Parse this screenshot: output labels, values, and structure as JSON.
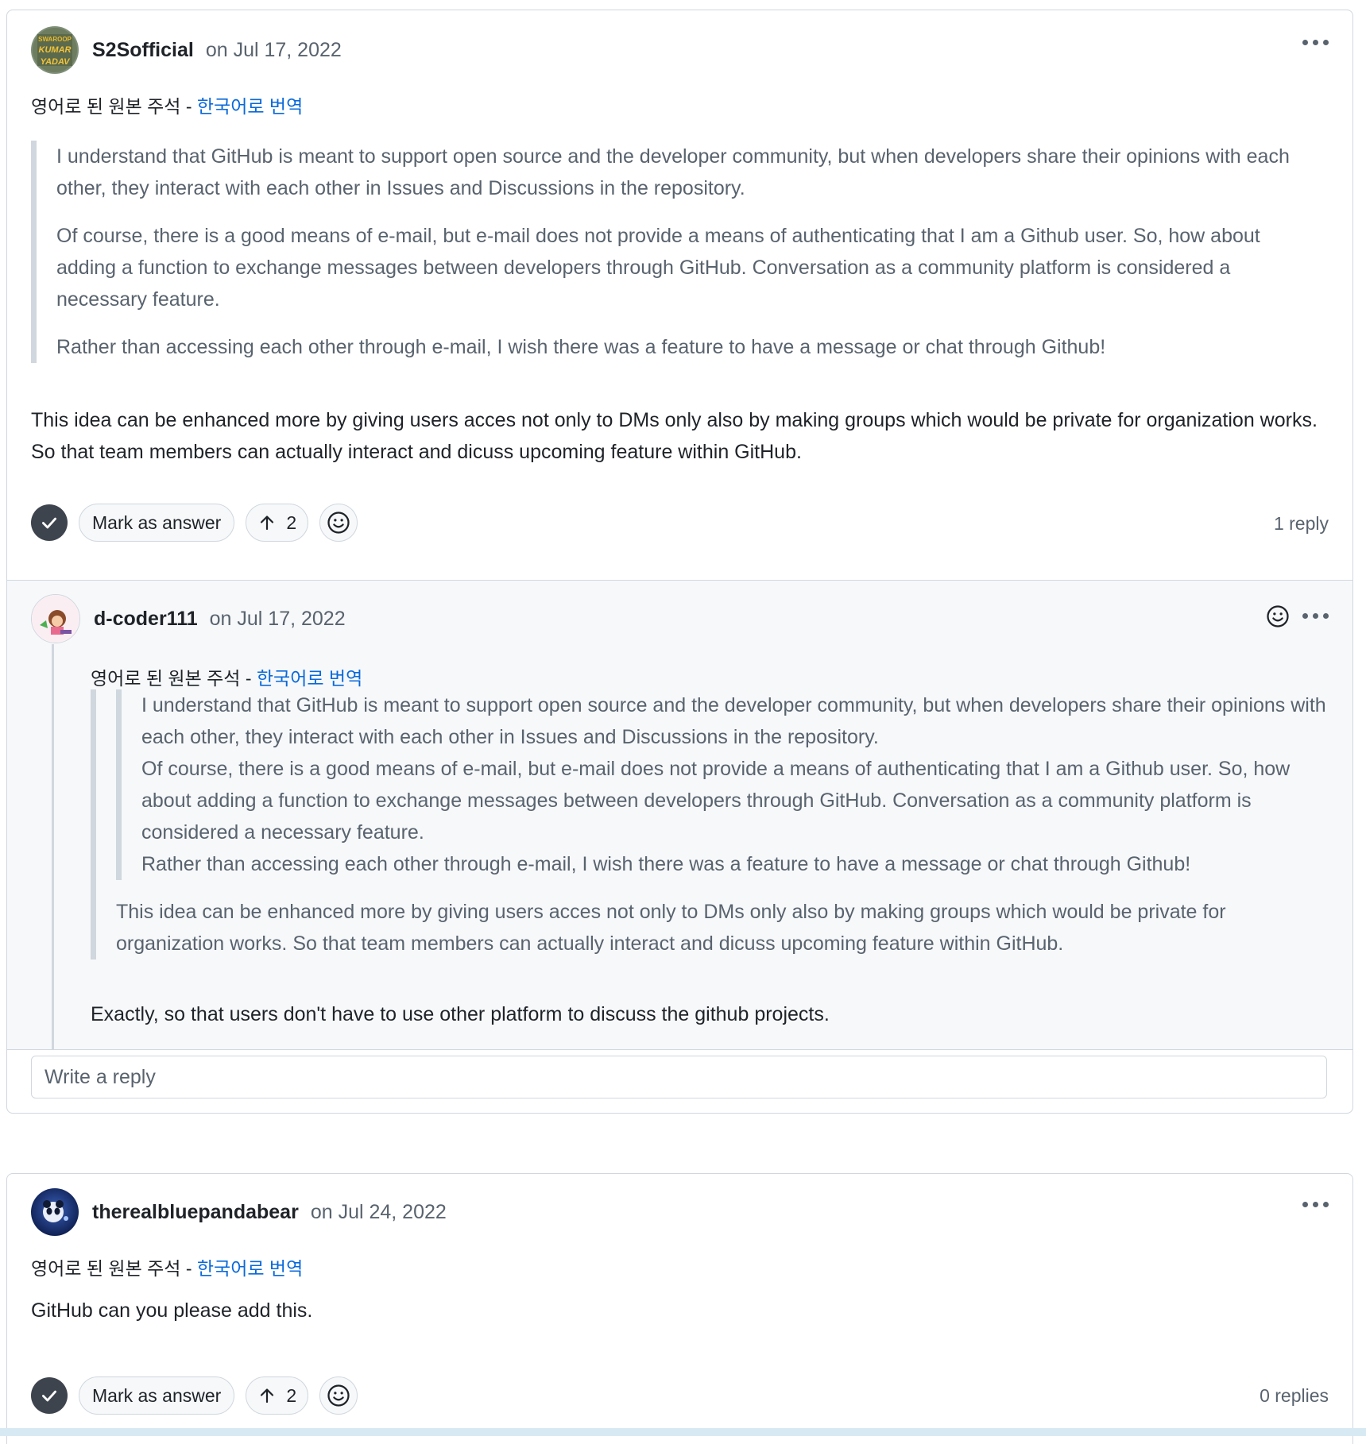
{
  "comments": [
    {
      "author": "S2Sofficial",
      "date": "on Jul 17, 2022",
      "translation": {
        "prefix": "영어로 된 원본 주석 - ",
        "link": "한국어로 번역"
      },
      "quote": [
        "I understand that GitHub is meant to support open source and the developer community, but when developers share their opinions with each other, they interact with each other in Issues and Discussions in the repository.",
        "Of course, there is a good means of e-mail, but e-mail does not provide a means of authenticating that I am a Github user. So, how about adding a function to exchange messages between developers through GitHub. Conversation as a community platform is considered a necessary feature.",
        "Rather than accessing each other through e-mail, I wish there was a feature to have a message or chat through Github!"
      ],
      "body": "This idea can be enhanced more by giving users acces not only to DMs only also by making groups which would be private for organization works. So that team members can actually interact and dicuss upcoming feature within GitHub.",
      "mark_answer": "Mark as answer",
      "upvotes": "2",
      "reply_count": "1 reply",
      "reply": {
        "author": "d-coder111",
        "date": "on Jul 17, 2022",
        "translation": {
          "prefix": "영어로 된 원본 주석 - ",
          "link": "한국어로 번역"
        },
        "nested_quote": [
          "I understand that GitHub is meant to support open source and the developer community, but when developers share their opinions with each other, they interact with each other in Issues and Discussions in the repository.",
          "Of course, there is a good means of e-mail, but e-mail does not provide a means of authenticating that I am a Github user. So, how about adding a function to exchange messages between developers through GitHub. Conversation as a community platform is considered a necessary feature.",
          "Rather than accessing each other through e-mail, I wish there was a feature to have a message or chat through Github!"
        ],
        "quote": "This idea can be enhanced more by giving users acces not only to DMs only also by making groups which would be private for organization works. So that team members can actually interact and dicuss upcoming feature within GitHub.",
        "body": "Exactly, so that users don't have to use other platform to discuss the github projects."
      },
      "reply_placeholder": "Write a reply"
    },
    {
      "author": "therealbluepandabear",
      "date": "on Jul 24, 2022",
      "translation": {
        "prefix": "영어로 된 원본 주석 - ",
        "link": "한국어로 번역"
      },
      "body": "GitHub can you please add this.",
      "mark_answer": "Mark as answer",
      "upvotes": "2",
      "reply_count": "0 replies"
    }
  ],
  "avatar_text": [
    "SWAROOP",
    "KUMAR",
    "YADAV"
  ],
  "colors": {
    "link": "#0969da",
    "border": "#d0d7de",
    "muted": "#59636e",
    "check": "#3d444d"
  }
}
